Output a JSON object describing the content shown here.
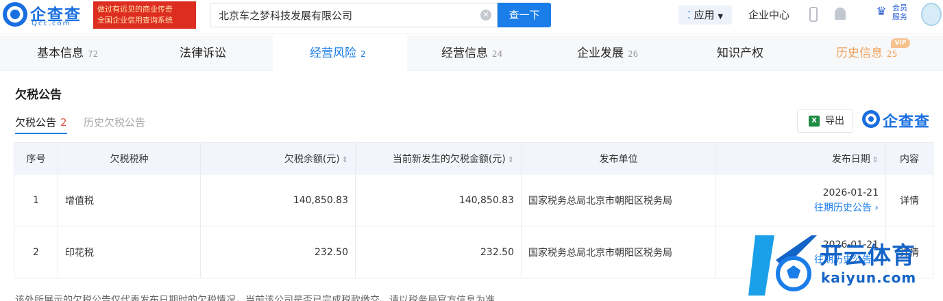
{
  "header": {
    "logo_text": "企查查",
    "logo_sub": "Qcc.com",
    "slogan_line1": "做过有远见的商业传奇",
    "slogan_line2": "全国企业信用查询系统",
    "search_value": "北京车之梦科技发展有限公司",
    "search_button": "查一下",
    "app_label": "应用",
    "enterprise_center": "企业中心",
    "member_label": "会员\n服务"
  },
  "tabs": [
    {
      "label": "基本信息",
      "count": "72"
    },
    {
      "label": "法律诉讼",
      "count": ""
    },
    {
      "label": "经营风险",
      "count": "2"
    },
    {
      "label": "经营信息",
      "count": "24"
    },
    {
      "label": "企业发展",
      "count": "26"
    },
    {
      "label": "知识产权",
      "count": ""
    },
    {
      "label": "历史信息",
      "count": "25"
    }
  ],
  "vip_badge": "VIP",
  "section": {
    "title": "欠税公告",
    "subtab_active": "欠税公告",
    "subtab_active_count": "2",
    "subtab_inactive": "历史欠税公告",
    "export_label": "导出",
    "brand": "企查查"
  },
  "table": {
    "headers": [
      "序号",
      "欠税税种",
      "欠税余额(元)",
      "当前新发生的欠税金额(元)",
      "发布单位",
      "发布日期",
      "内容"
    ],
    "rows": [
      {
        "idx": "1",
        "tax_type": "增值税",
        "balance": "140,850.83",
        "new_amount": "140,850.83",
        "publisher": "国家税务总局北京市朝阳区税务局",
        "date": "2026-01-21",
        "history_link": "往期历史公告",
        "detail": "详情"
      },
      {
        "idx": "2",
        "tax_type": "印花税",
        "balance": "232.50",
        "new_amount": "232.50",
        "publisher": "国家税务总局北京市朝阳区税务局",
        "date": "2026-01-21",
        "history_link": "往期历史公告",
        "detail": "详情"
      }
    ]
  },
  "footer_note": "该处所展示的欠税公告仅代表发布日期时的欠税情况，当前该公司是否已完成税款缴交，请以税务局官方信息为准",
  "watermark": {
    "cn": "开云体育",
    "en": "kaiyun.com"
  },
  "colors": {
    "primary": "#1a7de8",
    "brand": "#1a6fe0",
    "slogan_bg": "#dd2d20",
    "history_tab": "#f0a05a",
    "count_red": "#e0543b"
  }
}
